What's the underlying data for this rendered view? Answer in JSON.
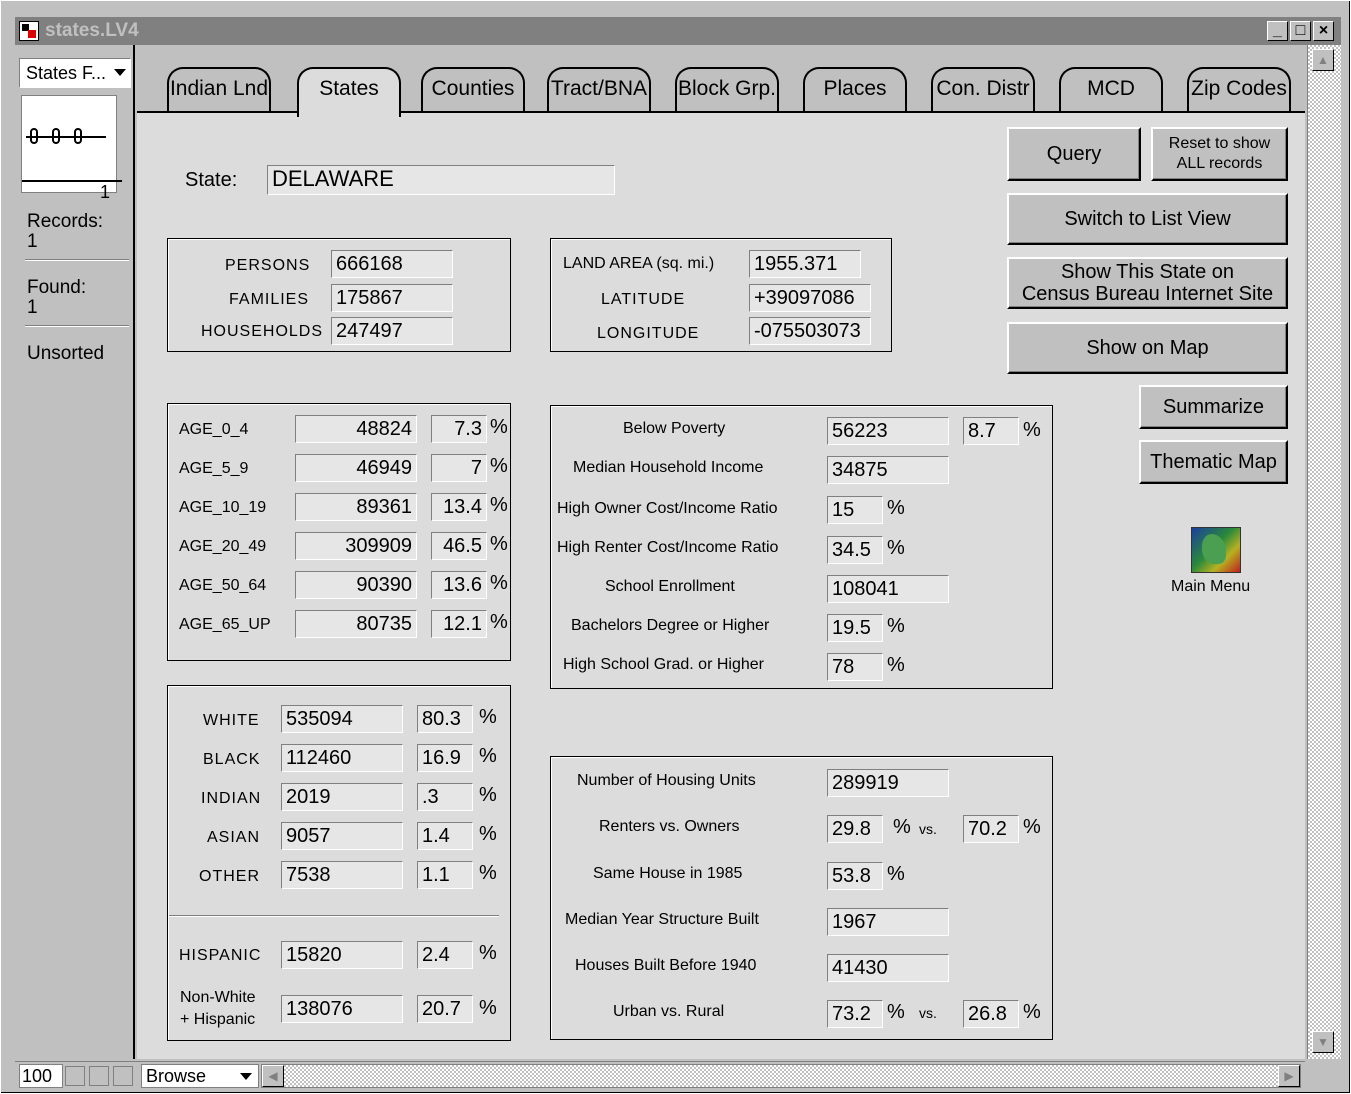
{
  "window": {
    "title": "states.LV4"
  },
  "sidebar": {
    "layout_menu": "States F...",
    "record_num": "1",
    "records_label": "Records:",
    "records_value": "1",
    "found_label": "Found:",
    "found_value": "1",
    "sort_status": "Unsorted"
  },
  "tabs": [
    {
      "label": "Indian Lnd"
    },
    {
      "label": "States"
    },
    {
      "label": "Counties"
    },
    {
      "label": "Tract/BNA"
    },
    {
      "label": "Block Grp."
    },
    {
      "label": "Places"
    },
    {
      "label": "Con. Distr"
    },
    {
      "label": "MCD"
    },
    {
      "label": "Zip Codes"
    }
  ],
  "state": {
    "label": "State:",
    "value": "DELAWARE"
  },
  "population": {
    "persons_label": "PERSONS",
    "persons": "666168",
    "families_label": "FAMILIES",
    "families": "175867",
    "households_label": "HOUSEHOLDS",
    "households": "247497"
  },
  "geo": {
    "land_label": "LAND AREA (sq. mi.)",
    "land": "1955.371",
    "lat_label": "LATITUDE",
    "lat": "+39097086",
    "lon_label": "LONGITUDE",
    "lon": "-075503073"
  },
  "ages": [
    {
      "label": "AGE_0_4",
      "count": "48824",
      "pct": "7.3"
    },
    {
      "label": "AGE_5_9",
      "count": "46949",
      "pct": "7"
    },
    {
      "label": "AGE_10_19",
      "count": "89361",
      "pct": "13.4"
    },
    {
      "label": "AGE_20_49",
      "count": "309909",
      "pct": "46.5"
    },
    {
      "label": "AGE_50_64",
      "count": "90390",
      "pct": "13.6"
    },
    {
      "label": "AGE_65_UP",
      "count": "80735",
      "pct": "12.1"
    }
  ],
  "race": [
    {
      "label": "WHITE",
      "count": "535094",
      "pct": "80.3"
    },
    {
      "label": "BLACK",
      "count": "112460",
      "pct": "16.9"
    },
    {
      "label": "INDIAN",
      "count": "2019",
      "pct": ".3"
    },
    {
      "label": "ASIAN",
      "count": "9057",
      "pct": "1.4"
    },
    {
      "label": "OTHER",
      "count": "7538",
      "pct": "1.1"
    }
  ],
  "hispanic": {
    "label": "HISPANIC",
    "count": "15820",
    "pct": "2.4"
  },
  "nonwhite": {
    "label1": "Non-White",
    "label2": "+ Hispanic",
    "count": "138076",
    "pct": "20.7"
  },
  "econ": {
    "poverty_label": "Below Poverty",
    "poverty": "56223",
    "poverty_pct": "8.7",
    "income_label": "Median Household Income",
    "income": "34875",
    "owner_label": "High Owner Cost/Income Ratio",
    "owner": "15",
    "renter_label": "High Renter Cost/Income Ratio",
    "renter": "34.5",
    "school_label": "School Enrollment",
    "school": "108041",
    "bach_label": "Bachelors Degree or Higher",
    "bach": "19.5",
    "hs_label": "High School Grad. or Higher",
    "hs": "78"
  },
  "housing": {
    "units_label": "Number of Housing Units",
    "units": "289919",
    "rent_label": "Renters vs. Owners",
    "renters": "29.8",
    "owners": "70.2",
    "same_label": "Same House in 1985",
    "same": "53.8",
    "year_label": "Median Year Structure Built",
    "year": "1967",
    "before_label": "Houses Built Before 1940",
    "before": "41430",
    "urban_label": "Urban vs. Rural",
    "urban": "73.2",
    "rural": "26.8",
    "vs": "vs."
  },
  "pct_sign": "%",
  "buttons": {
    "query": "Query",
    "reset1": "Reset to show",
    "reset2": "ALL records",
    "list_view": "Switch to List View",
    "census1": "Show This State on",
    "census2": "Census Bureau Internet Site",
    "map": "Show on Map",
    "summarize": "Summarize",
    "thematic": "Thematic Map",
    "main_menu": "Main Menu"
  },
  "statusbar": {
    "zoom": "100",
    "mode": "Browse"
  }
}
